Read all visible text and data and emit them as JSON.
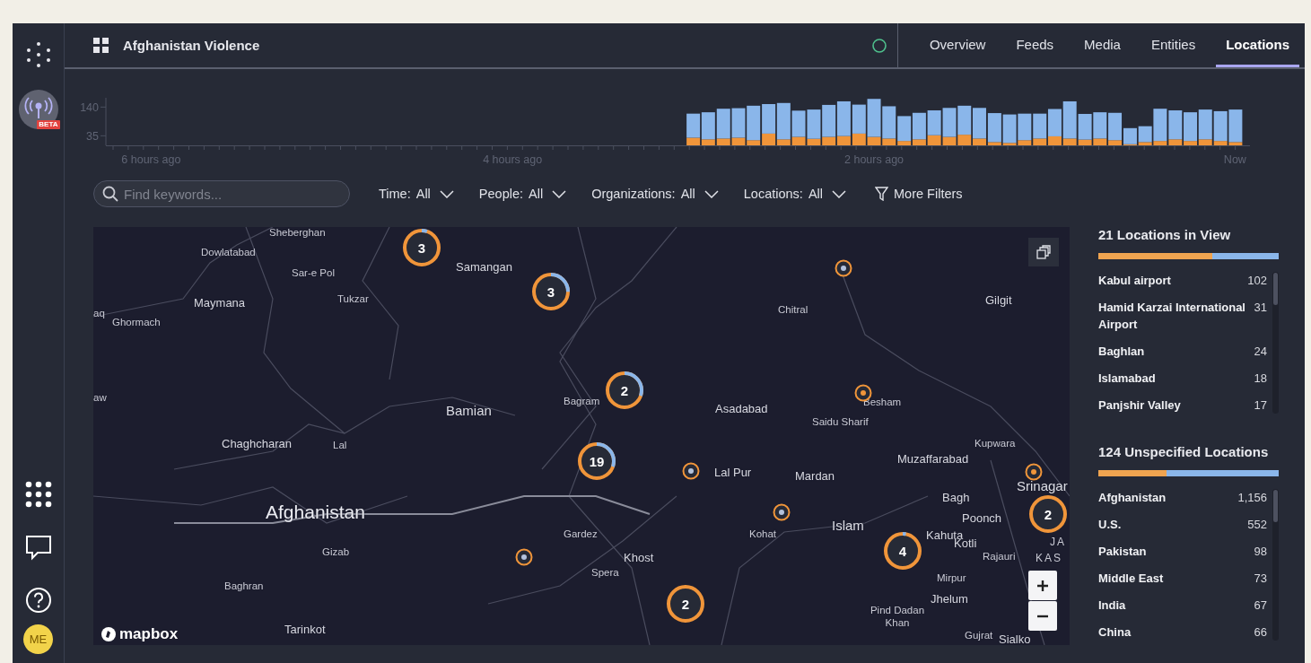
{
  "rail": {
    "beta_badge": "BETA",
    "avatar": "ME"
  },
  "header": {
    "title": "Afghanistan Violence"
  },
  "tabs": [
    {
      "label": "Overview",
      "selected": false
    },
    {
      "label": "Feeds",
      "selected": false
    },
    {
      "label": "Media",
      "selected": false
    },
    {
      "label": "Entities",
      "selected": false
    },
    {
      "label": "Locations",
      "selected": true
    }
  ],
  "timeline": {
    "chart_data": {
      "type": "bar",
      "stacked": true,
      "x": [
        3,
        2.917,
        2.833,
        2.75,
        2.667,
        2.583,
        2.5,
        2.417,
        2.333,
        2.25,
        2.167,
        2.083,
        2,
        1.917,
        1.833,
        1.75,
        1.667,
        1.583,
        1.5,
        1.417,
        1.333,
        1.25,
        1.167,
        1.083,
        1,
        0.917,
        0.833,
        0.75,
        0.667,
        0.583,
        0.5,
        0.417,
        0.333,
        0.25,
        0.167,
        0.083,
        0
      ],
      "series": [
        {
          "color": "#f0953a",
          "values": [
            28,
            22,
            25,
            28,
            19,
            43,
            22,
            31,
            24,
            31,
            34,
            43,
            31,
            25,
            16,
            22,
            37,
            31,
            39,
            25,
            12,
            9,
            19,
            25,
            33,
            25,
            21,
            25,
            19,
            4,
            12,
            16,
            22,
            16,
            22,
            16,
            12
          ]
        },
        {
          "color": "#8ab6ea",
          "values": [
            88,
            99,
            109,
            108,
            126,
            108,
            133,
            96,
            107,
            117,
            127,
            106,
            139,
            118,
            91,
            97,
            91,
            106,
            106,
            112,
            106,
            104,
            97,
            91,
            100,
            136,
            94,
            96,
            100,
            59,
            58,
            118,
            106,
            105,
            109,
            109,
            119
          ]
        }
      ],
      "xlim": [
        6.25,
        -0.08
      ],
      "ylim": [
        0,
        175
      ],
      "yticks": [
        35,
        140
      ],
      "xticks": [
        {
          "value": 6,
          "label": "6 hours ago"
        },
        {
          "value": 4,
          "label": "4 hours ago"
        },
        {
          "value": 2,
          "label": "2 hours ago"
        },
        {
          "value": 0,
          "label": "Now"
        }
      ]
    }
  },
  "search": {
    "placeholder": "Find keywords..."
  },
  "filters": [
    {
      "label": "Time:",
      "value": "All"
    },
    {
      "label": "People:",
      "value": "All"
    },
    {
      "label": "Organizations:",
      "value": "All"
    },
    {
      "label": "Locations:",
      "value": "All"
    }
  ],
  "more_filters": "More Filters",
  "map": {
    "labels": [
      {
        "text": "Sheberghan",
        "kind": "town"
      },
      {
        "text": "Dowlatabad",
        "kind": "town"
      },
      {
        "text": "Sar-e Pol",
        "kind": "town"
      },
      {
        "text": "Maymana",
        "kind": "city"
      },
      {
        "text": "Tukzar",
        "kind": "town"
      },
      {
        "text": "Ghormach",
        "kind": "town"
      },
      {
        "text": "aq",
        "kind": "town"
      },
      {
        "text": "aw",
        "kind": "town"
      },
      {
        "text": "Samangan",
        "kind": "city"
      },
      {
        "text": "Bamian",
        "kind": "big"
      },
      {
        "text": "Chaghcharan",
        "kind": "city"
      },
      {
        "text": "Lal",
        "kind": "town"
      },
      {
        "text": "Afghanistan",
        "kind": "country"
      },
      {
        "text": "Gizab",
        "kind": "town"
      },
      {
        "text": "Baghran",
        "kind": "town"
      },
      {
        "text": "Tarinkot",
        "kind": "city"
      },
      {
        "text": "Bagram",
        "kind": "town"
      },
      {
        "text": "Gardez",
        "kind": "town"
      },
      {
        "text": "Khost",
        "kind": "city"
      },
      {
        "text": "Spera",
        "kind": "town"
      },
      {
        "text": "Chitral",
        "kind": "town"
      },
      {
        "text": "Gilgit",
        "kind": "city"
      },
      {
        "text": "Besham",
        "kind": "town"
      },
      {
        "text": "Asadabad",
        "kind": "city"
      },
      {
        "text": "Saidu Sharif",
        "kind": "town"
      },
      {
        "text": "Kupwara",
        "kind": "town"
      },
      {
        "text": "Muzaffarabad",
        "kind": "city"
      },
      {
        "text": "Lal Pur",
        "kind": "city"
      },
      {
        "text": "Mardan",
        "kind": "city"
      },
      {
        "text": "Srinagar",
        "kind": "big"
      },
      {
        "text": "Bagh",
        "kind": "city"
      },
      {
        "text": "Poonch",
        "kind": "city"
      },
      {
        "text": "Kohat",
        "kind": "town"
      },
      {
        "text": "Islam",
        "kind": "big"
      },
      {
        "text": "Kahuta",
        "kind": "city"
      },
      {
        "text": "Kotli",
        "kind": "city"
      },
      {
        "text": "Rajauri",
        "kind": "town"
      },
      {
        "text": "Mirpur",
        "kind": "town"
      },
      {
        "text": "Jhelum",
        "kind": "city"
      },
      {
        "text": "Pind Dadan Khan",
        "kind": "town"
      },
      {
        "text": "Gujrat",
        "kind": "town"
      },
      {
        "text": "Sialko",
        "kind": "city"
      },
      {
        "text": "JA",
        "kind": "region"
      },
      {
        "text": "KAS",
        "kind": "region"
      }
    ],
    "clusters": [
      {
        "count": "3",
        "level": 0.05
      },
      {
        "count": "3",
        "level": 0.25
      },
      {
        "count": "2",
        "level": 0.3
      },
      {
        "count": "19",
        "level": 0.3
      },
      {
        "count": "4",
        "level": 0.03
      },
      {
        "count": "2",
        "level": 0
      },
      {
        "count": "2",
        "level": 0
      }
    ],
    "points": [
      {
        "color": "#b3c2dc"
      },
      {
        "color": "#f0953a"
      },
      {
        "color": "#b3c2dc"
      },
      {
        "color": "#b3c2dc"
      },
      {
        "color": "#f0953a"
      },
      {
        "color": "#b3c2dc"
      }
    ],
    "attribution": "mapbox"
  },
  "panels": [
    {
      "title": "21 Locations in View",
      "level": 0.63,
      "rows": [
        {
          "name": "Kabul airport",
          "count": "102"
        },
        {
          "name": "Hamid Karzai International Airport",
          "count": "31"
        },
        {
          "name": "Baghlan",
          "count": "24"
        },
        {
          "name": "Islamabad",
          "count": "18"
        },
        {
          "name": "Panjshir Valley",
          "count": "17"
        }
      ]
    },
    {
      "title": "124 Unspecified Locations",
      "level": 0.38,
      "rows": [
        {
          "name": "Afghanistan",
          "count": "1,156"
        },
        {
          "name": "U.S.",
          "count": "552"
        },
        {
          "name": "Pakistan",
          "count": "98"
        },
        {
          "name": "Middle East",
          "count": "73"
        },
        {
          "name": "India",
          "count": "67"
        },
        {
          "name": "China",
          "count": "66"
        }
      ]
    }
  ]
}
